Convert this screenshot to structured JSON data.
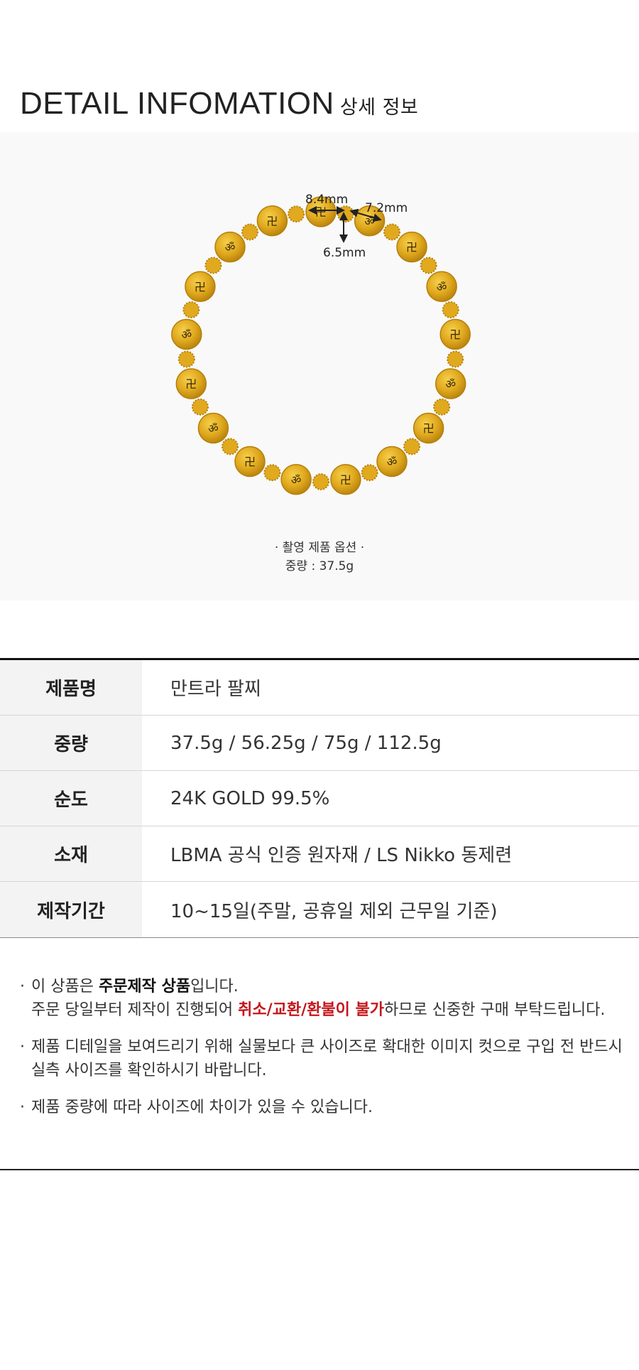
{
  "header": {
    "title": "DETAIL INFOMATION",
    "subtitle": "상세 정보"
  },
  "photo": {
    "dimension_width": "8.4mm",
    "dimension_depth": "7.2mm",
    "dimension_height": "6.5mm",
    "caption_line1": "· 촬영 제품 옵션 ·",
    "caption_line2": "중량 : 37.5g",
    "bead_color": "#e0a91e",
    "bead_shadow": "#b57f0b"
  },
  "specs": [
    {
      "label": "제품명",
      "value": "만트라 팔찌"
    },
    {
      "label": "중량",
      "value": "37.5g / 56.25g / 75g / 112.5g"
    },
    {
      "label": "순도",
      "value": "24K GOLD 99.5%"
    },
    {
      "label": "소재",
      "value": "LBMA 공식 인증 원자재 / LS Nikko 동제련"
    },
    {
      "label": "제작기간",
      "value": "10~15일(주말, 공휴일 제외 근무일 기준)"
    }
  ],
  "notes": {
    "n1_a": "이 상품은 ",
    "n1_b": "주문제작 상품",
    "n1_c": "입니다.",
    "n1_d": "주문 당일부터 제작이 진행되어 ",
    "n1_e": "취소/교환/환불이 불가",
    "n1_f": "하므로 신중한 구매 부탁드립니다.",
    "n2_a": "제품 디테일을 보여드리기 위해 실물보다 큰 사이즈로 확대한 이미지 컷으로 구입 전 반드시",
    "n2_b": "실측 사이즈를 확인하시기 바랍니다.",
    "n3": " 제품 중량에 따라 사이즈에 차이가 있을 수 있습니다.",
    "bullet": "·"
  }
}
